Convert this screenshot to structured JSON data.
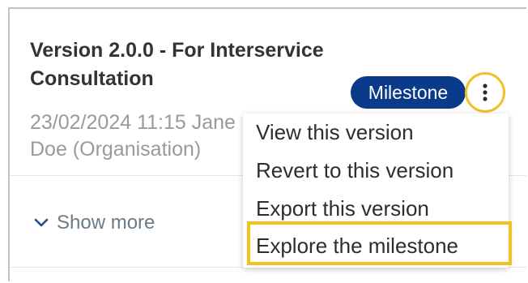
{
  "card": {
    "title": "Version 2.0.0 - For Interservice Consultation",
    "meta": "23/02/2024 11:15 Jane Doe (Organisation)",
    "badge": "Milestone",
    "more_icon": "kebab-vertical-icon",
    "show_more_label": "Show more",
    "show_more_icon": "chevron-down-icon"
  },
  "menu": {
    "items": [
      {
        "label": "View this version"
      },
      {
        "label": "Revert to this version"
      },
      {
        "label": "Export this version"
      },
      {
        "label": "Explore the milestone",
        "highlighted": true
      }
    ]
  },
  "colors": {
    "badge_bg": "#0a3a8a",
    "highlight": "#f4c020",
    "kebab_ring": "#f2c02a",
    "muted_text": "#9a9a9a",
    "title_text": "#333333"
  }
}
